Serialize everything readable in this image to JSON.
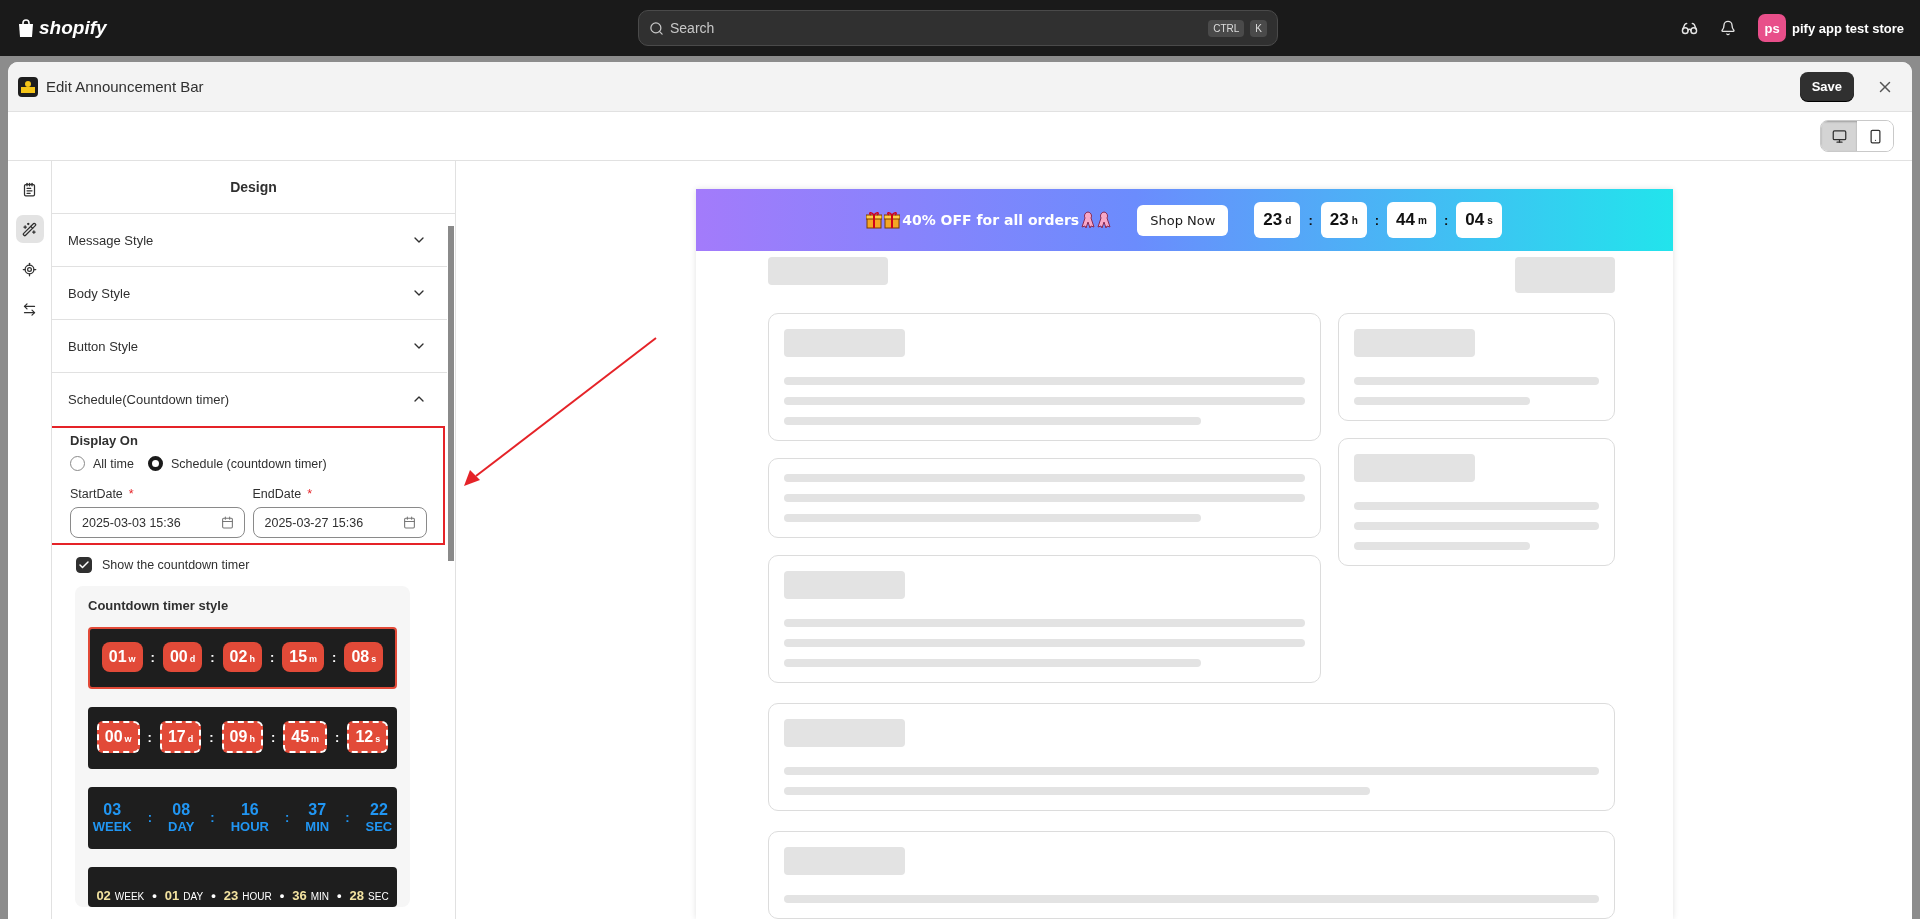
{
  "top_bar": {
    "logo": "shopify",
    "search": {
      "placeholder": "Search",
      "keys": [
        "CTRL",
        "K"
      ]
    },
    "store": {
      "initials": "ps",
      "name": "pify app test store"
    }
  },
  "modal": {
    "title": "Edit Announcement Bar",
    "save": "Save"
  },
  "view_toggle": [
    {
      "kind": "desktop",
      "selected": true
    },
    {
      "kind": "mobile",
      "selected": false
    }
  ],
  "rail": [
    {
      "kind": "list",
      "selected": false
    },
    {
      "kind": "wand",
      "selected": true
    },
    {
      "kind": "target",
      "selected": false
    },
    {
      "kind": "swap",
      "selected": false
    }
  ],
  "panel": {
    "title": "Design",
    "sections": [
      {
        "label": "Message Style",
        "expanded": false
      },
      {
        "label": "Body Style",
        "expanded": false
      },
      {
        "label": "Button Style",
        "expanded": false
      },
      {
        "label": "Schedule(Countdown timer)",
        "expanded": true
      }
    ],
    "display_on": {
      "label": "Display On",
      "options": [
        {
          "label": "All time",
          "selected": false
        },
        {
          "label": "Schedule (countdown timer)",
          "selected": true
        }
      ]
    },
    "dates": [
      {
        "label": "StartDate",
        "required_mark": "*",
        "value": "2025-03-03 15:36"
      },
      {
        "label": "EndDate",
        "required_mark": "*",
        "value": "2025-03-27 15:36"
      }
    ],
    "show_timer": {
      "label": "Show the countdown timer",
      "checked": true
    },
    "timer_styles": {
      "title": "Countdown timer style",
      "items": [
        {
          "kind": "boxed",
          "selected": true,
          "separator": ":",
          "units": [
            {
              "value": "01",
              "unit": "w"
            },
            {
              "value": "00",
              "unit": "d"
            },
            {
              "value": "02",
              "unit": "h"
            },
            {
              "value": "15",
              "unit": "m"
            },
            {
              "value": "08",
              "unit": "s"
            }
          ]
        },
        {
          "kind": "dashed",
          "selected": false,
          "separator": ":",
          "units": [
            {
              "value": "00",
              "unit": "w"
            },
            {
              "value": "17",
              "unit": "d"
            },
            {
              "value": "09",
              "unit": "h"
            },
            {
              "value": "45",
              "unit": "m"
            },
            {
              "value": "12",
              "unit": "s"
            }
          ]
        },
        {
          "kind": "stacked",
          "selected": false,
          "separator": ":",
          "units": [
            {
              "value": "03",
              "unit": "WEEK"
            },
            {
              "value": "08",
              "unit": "DAY"
            },
            {
              "value": "16",
              "unit": "HOUR"
            },
            {
              "value": "37",
              "unit": "MIN"
            },
            {
              "value": "22",
              "unit": "SEC"
            }
          ]
        },
        {
          "kind": "inline",
          "selected": false,
          "separator": "•",
          "units": [
            {
              "value": "02",
              "unit": "WEEK"
            },
            {
              "value": "01",
              "unit": "DAY"
            },
            {
              "value": "23",
              "unit": "HOUR"
            },
            {
              "value": "36",
              "unit": "MIN"
            },
            {
              "value": "28",
              "unit": "SEC"
            }
          ]
        }
      ]
    }
  },
  "preview": {
    "banner": {
      "message": "40% OFF for all orders",
      "button": "Shop Now",
      "separator": ":",
      "timer": [
        {
          "value": "23",
          "unit": "d"
        },
        {
          "value": "23",
          "unit": "h"
        },
        {
          "value": "44",
          "unit": "m"
        },
        {
          "value": "04",
          "unit": "s"
        }
      ]
    }
  }
}
